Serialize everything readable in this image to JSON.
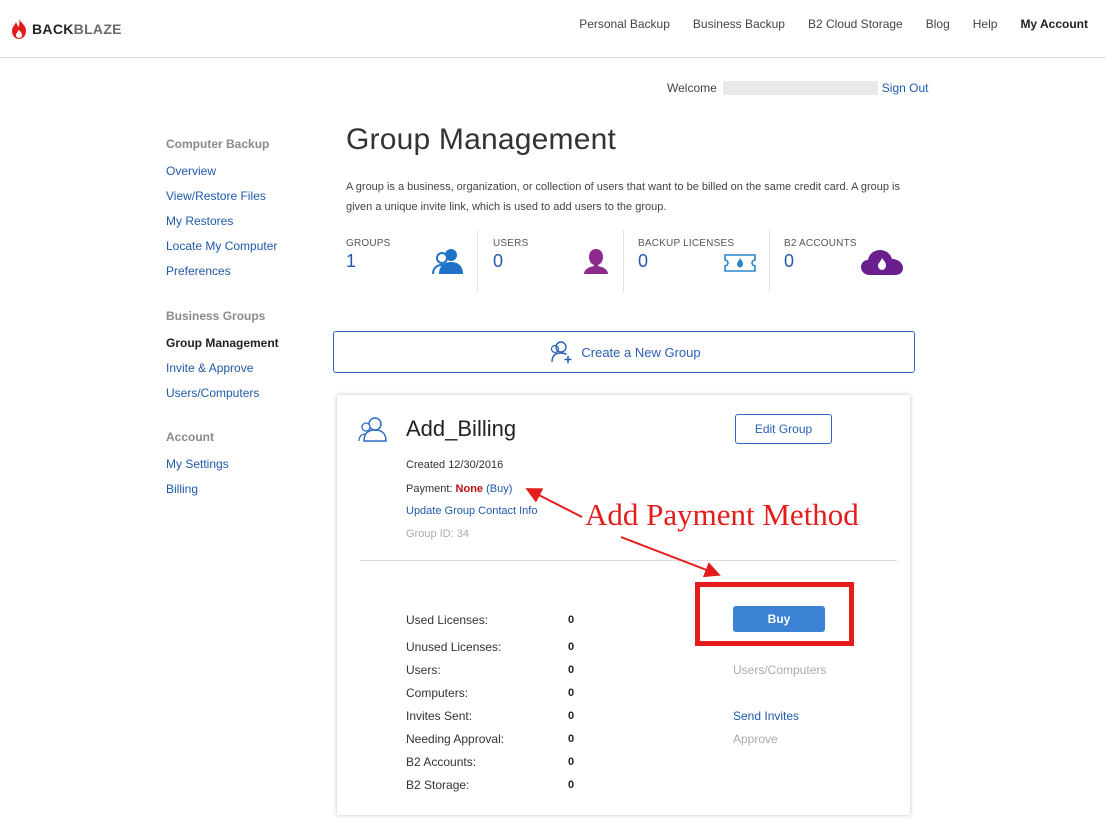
{
  "brand": {
    "part1": "BACK",
    "part2": "BLAZE"
  },
  "topnav": [
    "Personal Backup",
    "Business Backup",
    "B2 Cloud Storage",
    "Blog",
    "Help",
    "My Account"
  ],
  "welcome": {
    "label": "Welcome",
    "signout": "Sign Out"
  },
  "sidebar": {
    "computer_backup": {
      "heading": "Computer Backup",
      "items": [
        "Overview",
        "View/Restore Files",
        "My Restores",
        "Locate My Computer",
        "Preferences"
      ]
    },
    "business_groups": {
      "heading": "Business Groups",
      "items": [
        "Group Management",
        "Invite & Approve",
        "Users/Computers"
      ]
    },
    "account": {
      "heading": "Account",
      "items": [
        "My Settings",
        "Billing"
      ]
    }
  },
  "page": {
    "title": "Group Management",
    "description": "A group is a business, organization, or collection of users that want to be billed on the same credit card. A group is given a unique invite link, which is used to add users to the group."
  },
  "stats": [
    {
      "label": "GROUPS",
      "value": "1",
      "icon": "group-icon"
    },
    {
      "label": "USERS",
      "value": "0",
      "icon": "user-icon"
    },
    {
      "label": "BACKUP LICENSES",
      "value": "0",
      "icon": "ticket-icon"
    },
    {
      "label": "B2 ACCOUNTS",
      "value": "0",
      "icon": "cloud-icon"
    }
  ],
  "create_group": {
    "label": "Create a New Group"
  },
  "group": {
    "name": "Add_Billing",
    "edit_label": "Edit Group",
    "created": "Created 12/30/2016",
    "payment_label": "Payment:",
    "payment_value": "None",
    "payment_buy": "(Buy)",
    "update_contact": "Update Group Contact Info",
    "group_id": "Group ID: 34",
    "rows": [
      {
        "label": "Used Licenses:",
        "value": "0"
      },
      {
        "label": "Unused Licenses:",
        "value": "0"
      },
      {
        "label": "Users:",
        "value": "0"
      },
      {
        "label": "Computers:",
        "value": "0"
      },
      {
        "label": "Invites Sent:",
        "value": "0"
      },
      {
        "label": "Needing Approval:",
        "value": "0"
      },
      {
        "label": "B2 Accounts:",
        "value": "0"
      },
      {
        "label": "B2 Storage:",
        "value": "0"
      }
    ],
    "buy_label": "Buy",
    "users_computers": "Users/Computers",
    "send_invites": "Send Invites",
    "approve": "Approve"
  },
  "annotation": "Add Payment Method",
  "colors": {
    "link": "#1f5aa8",
    "annotation": "#e41c1c",
    "buy_button": "#3b82d4",
    "users_icon": "#8e2a8e",
    "b2_icon": "#6a1f8e"
  }
}
